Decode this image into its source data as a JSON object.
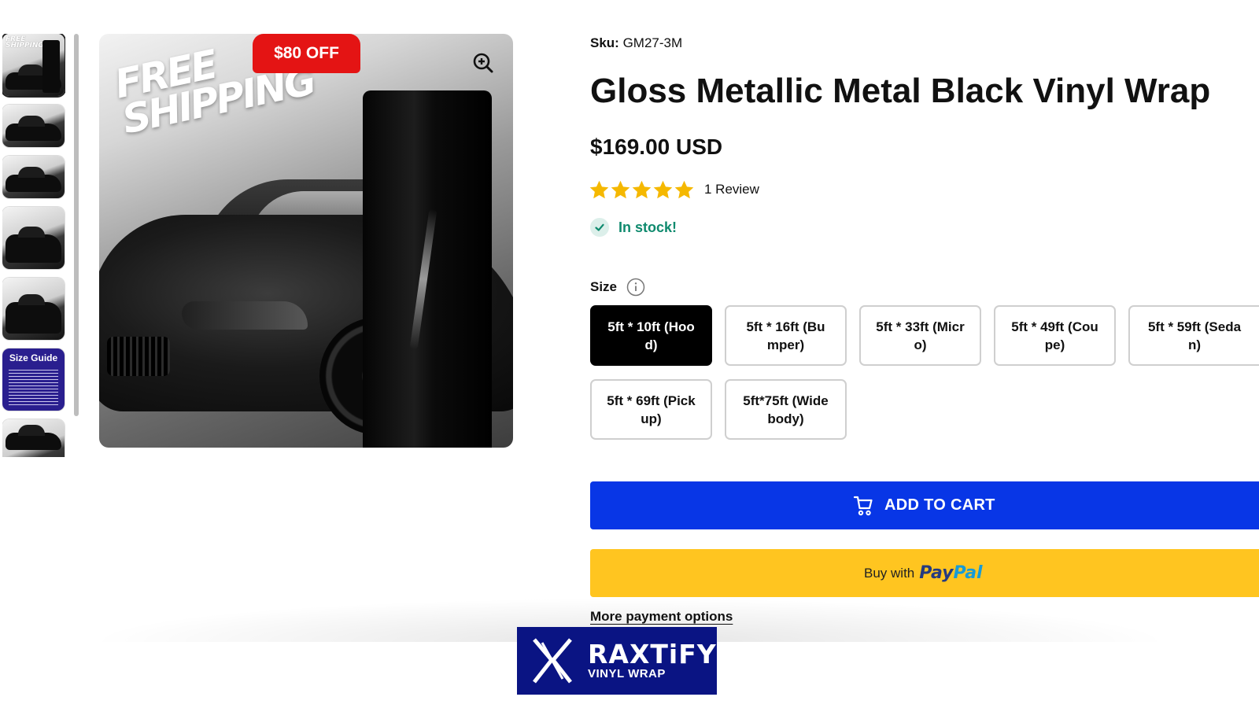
{
  "gallery": {
    "badge": "$80 OFF",
    "promo_text": "FREE SHIPPING",
    "thumb_promo": "FREE SHIPPING",
    "size_guide_label": "Size Guide",
    "zoom_icon": "zoom-in-icon"
  },
  "product": {
    "sku_label": "Sku:",
    "sku_value": "GM27-3M",
    "title": "Gloss Metallic Metal Black Vinyl Wrap",
    "price": "$169.00 USD",
    "rating": 5,
    "rating_max": 5,
    "review_text": "1 Review",
    "stock_text": "In stock!"
  },
  "size": {
    "label": "Size",
    "options": [
      {
        "label": "5ft * 10ft (Hood)",
        "selected": true
      },
      {
        "label": "5ft * 16ft (Bumper)",
        "selected": false
      },
      {
        "label": "5ft * 33ft (Micro)",
        "selected": false
      },
      {
        "label": "5ft * 49ft (Coupe)",
        "selected": false
      },
      {
        "label": "5ft * 59ft (Sedan)",
        "selected": false
      },
      {
        "label": "5ft * 69ft (Pickup)",
        "selected": false
      },
      {
        "label": "5ft*75ft (Widebody)",
        "selected": false
      }
    ]
  },
  "actions": {
    "add_to_cart": "ADD TO CART",
    "buy_with": "Buy with",
    "paypal_1": "Pay",
    "paypal_2": "Pal",
    "more_payment": "More payment options"
  },
  "logo": {
    "name": "RAXTiFY",
    "sub": "VINYL WRAP"
  },
  "colors": {
    "primary_button": "#0836e6",
    "paypal_button": "#ffc520",
    "badge": "#e41414",
    "stock": "#0f8a6e",
    "star": "#f5b800",
    "logo_bg": "#0a1483"
  }
}
